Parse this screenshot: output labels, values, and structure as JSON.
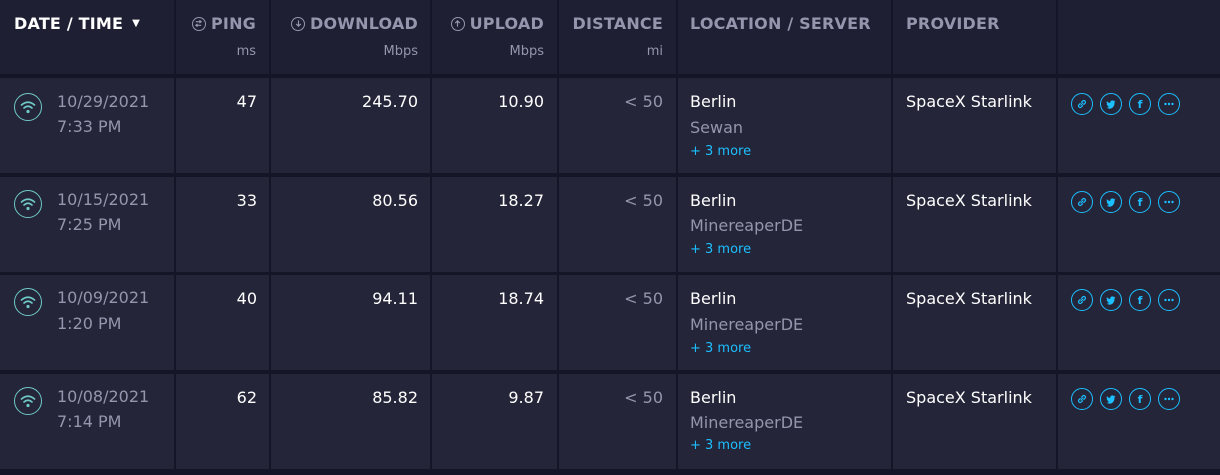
{
  "header": {
    "datetime": "DATE / TIME",
    "ping": "PING",
    "ping_unit": "ms",
    "download": "DOWNLOAD",
    "download_unit": "Mbps",
    "upload": "UPLOAD",
    "upload_unit": "Mbps",
    "distance": "DISTANCE",
    "distance_unit": "mi",
    "location": "LOCATION / SERVER",
    "provider": "PROVIDER"
  },
  "rows": [
    {
      "date": "10/29/2021",
      "time": "7:33 PM",
      "ping": "47",
      "download": "245.70",
      "upload": "10.90",
      "distance": "< 50",
      "location": "Berlin",
      "server": "Sewan",
      "more": "+ 3 more",
      "provider": "SpaceX Starlink"
    },
    {
      "date": "10/15/2021",
      "time": "7:25 PM",
      "ping": "33",
      "download": "80.56",
      "upload": "18.27",
      "distance": "< 50",
      "location": "Berlin",
      "server": "MinereaperDE",
      "more": "+ 3 more",
      "provider": "SpaceX Starlink"
    },
    {
      "date": "10/09/2021",
      "time": "1:20 PM",
      "ping": "40",
      "download": "94.11",
      "upload": "18.74",
      "distance": "< 50",
      "location": "Berlin",
      "server": "MinereaperDE",
      "more": "+ 3 more",
      "provider": "SpaceX Starlink"
    },
    {
      "date": "10/08/2021",
      "time": "7:14 PM",
      "ping": "62",
      "download": "85.82",
      "upload": "9.87",
      "distance": "< 50",
      "location": "Berlin",
      "server": "MinereaperDE",
      "more": "+ 3 more",
      "provider": "SpaceX Starlink"
    }
  ],
  "icons": {
    "row": "wifi-icon",
    "actions": [
      "link-icon",
      "twitter-icon",
      "facebook-icon",
      "more-icon"
    ],
    "facebook_glyph": "f"
  },
  "colors": {
    "background": "#141526",
    "row": "#242538",
    "header": "#1e1f33",
    "accent": "#1cbfff",
    "wifi": "#6fc9c7",
    "muted": "#9596ad"
  }
}
